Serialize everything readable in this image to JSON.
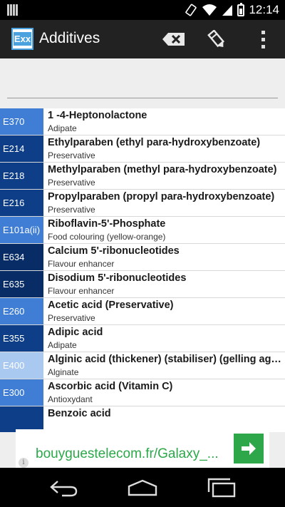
{
  "status_bar": {
    "time": "12:14"
  },
  "app": {
    "icon_text": "Exx",
    "title": "Additives"
  },
  "search": {
    "value": "",
    "placeholder": ""
  },
  "additives": [
    {
      "code": "E370",
      "name": "1 -4-Heptonolactone",
      "category": "Adipate",
      "color": "#3f7ed4"
    },
    {
      "code": "E214",
      "name": "Ethylparaben (ethyl para-hydroxybenzoate)",
      "category": "Preservative",
      "color": "#0d3e87"
    },
    {
      "code": "E218",
      "name": "Methylparaben (methyl para-hydroxybenzoate)",
      "category": "Preservative",
      "color": "#0d3e87"
    },
    {
      "code": "E216",
      "name": "Propylparaben (propyl para-hydroxybenzoate)",
      "category": "Preservative",
      "color": "#0d3e87"
    },
    {
      "code": "E101a(ii)",
      "name": "Riboflavin-5'-Phosphate",
      "category": "Food colouring (yellow-orange)",
      "color": "#3f7ed4"
    },
    {
      "code": "E634",
      "name": "Calcium 5'-ribonucleotides",
      "category": "Flavour enhancer",
      "color": "#082d66"
    },
    {
      "code": "E635",
      "name": "Disodium 5'-ribonucleotides",
      "category": "Flavour enhancer",
      "color": "#082d66"
    },
    {
      "code": "E260",
      "name": "Acetic acid (Preservative)",
      "category": "Preservative",
      "color": "#3f7ed4"
    },
    {
      "code": "E355",
      "name": "Adipic acid",
      "category": "Adipate",
      "color": "#0d3e87"
    },
    {
      "code": "E400",
      "name": "Alginic acid (thickener) (stabiliser) (gelling agent)",
      "category": "Alginate",
      "color": "#a9c9f0"
    },
    {
      "code": "E300",
      "name": "Ascorbic acid (Vitamin C)",
      "category": "Antioxydant",
      "color": "#3f7ed4"
    },
    {
      "code": "",
      "name": "Benzoic acid",
      "category": "",
      "color": "#0d3e87"
    }
  ],
  "ad": {
    "text": "bouyguestelecom.fr/Galaxy_...",
    "info_label": "i"
  },
  "icons": {
    "clear": "backspace-clear-icon",
    "edit": "edit-pencil-icon",
    "more": "overflow-menu-icon",
    "ad_arrow": "arrow-right-icon",
    "nav_back": "back-icon",
    "nav_home": "home-icon",
    "nav_recents": "recents-icon"
  }
}
